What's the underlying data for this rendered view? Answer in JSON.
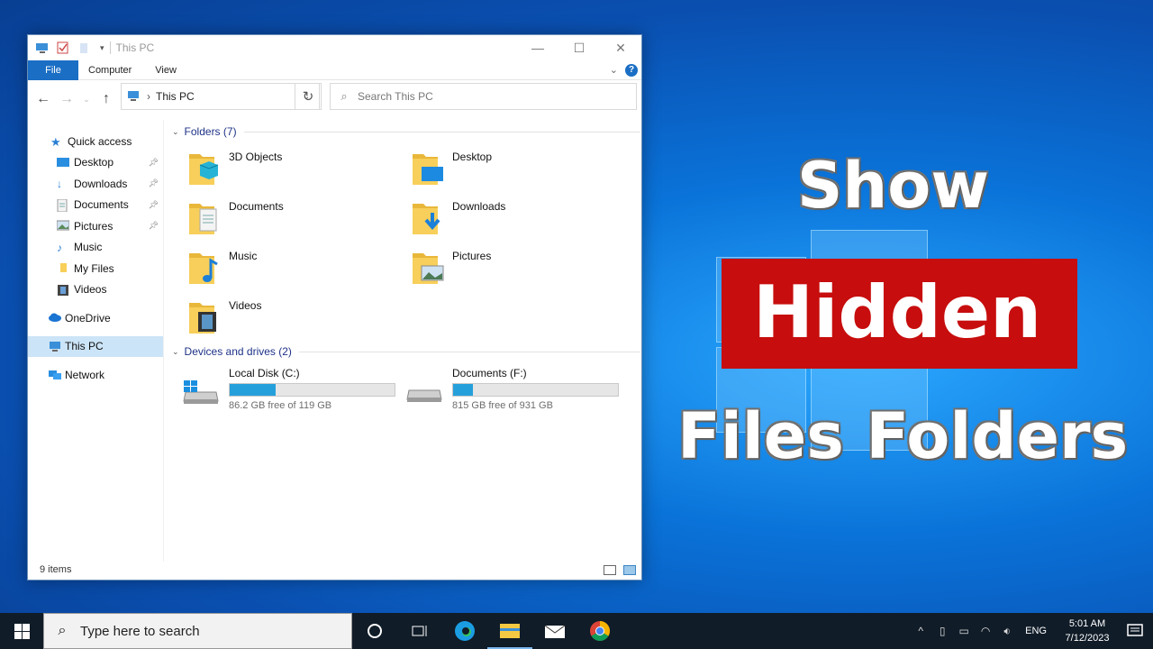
{
  "thumbnail": {
    "line1": "Show",
    "line2": "Hidden",
    "line3": "Files Folders",
    "highlight_color": "#c70d0d"
  },
  "window": {
    "title": "This PC",
    "ribbon_tabs": [
      "File",
      "Computer",
      "View"
    ],
    "address": "This PC",
    "search_placeholder": "Search This PC",
    "accent_color": "#1a6ec4"
  },
  "sidebar": {
    "quick_access": "Quick access",
    "items": [
      {
        "label": "Desktop",
        "icon": "desktop-icon",
        "pinned": true
      },
      {
        "label": "Downloads",
        "icon": "download-arrow-icon",
        "pinned": true
      },
      {
        "label": "Documents",
        "icon": "document-icon",
        "pinned": true
      },
      {
        "label": "Pictures",
        "icon": "picture-icon",
        "pinned": true
      },
      {
        "label": "Music",
        "icon": "music-note-icon",
        "pinned": false
      },
      {
        "label": "My Files",
        "icon": "folder-icon",
        "pinned": false
      },
      {
        "label": "Videos",
        "icon": "film-icon",
        "pinned": false
      }
    ],
    "onedrive": "OneDrive",
    "this_pc": "This PC",
    "network": "Network"
  },
  "content": {
    "folders_header": "Folders (7)",
    "folders": [
      "3D Objects",
      "Desktop",
      "Documents",
      "Downloads",
      "Music",
      "Pictures",
      "Videos"
    ],
    "drives_header": "Devices and drives (2)",
    "drives": [
      {
        "name": "Local Disk (C:)",
        "free": "86.2 GB free of 119 GB",
        "used_fraction": 0.28
      },
      {
        "name": "Documents (F:)",
        "free": "815 GB free of 931 GB",
        "used_fraction": 0.12
      }
    ]
  },
  "status": {
    "items": "9 items"
  },
  "taskbar": {
    "search_placeholder": "Type here to search",
    "lang": "ENG",
    "time": "5:01 AM",
    "date": "7/12/2023"
  }
}
